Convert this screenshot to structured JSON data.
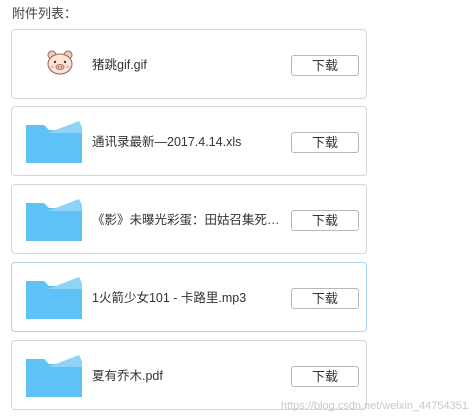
{
  "section_title": "附件列表：",
  "attachments": [
    {
      "name": "猪跳gif.gif",
      "icon": "pig-gif-icon",
      "download_label": "下载"
    },
    {
      "name": "通讯录最新—2017.4.14.xls",
      "icon": "folder-icon",
      "download_label": "下载"
    },
    {
      "name": "《影》未曝光彩蛋：田姑召集死士画面...",
      "icon": "folder-icon",
      "download_label": "下载"
    },
    {
      "name": "1火箭少女101 - 卡路里.mp3",
      "icon": "folder-icon",
      "download_label": "下载"
    },
    {
      "name": "夏有乔木.pdf",
      "icon": "folder-icon",
      "download_label": "下载"
    }
  ],
  "watermark": "https://blog.csdn.net/weixin_44754351",
  "colors": {
    "folder_front": "#5ec2f7",
    "folder_back": "#8fd3f8",
    "card_border": "#d6d6d6",
    "card_border_hover": "#a9d4f5"
  }
}
